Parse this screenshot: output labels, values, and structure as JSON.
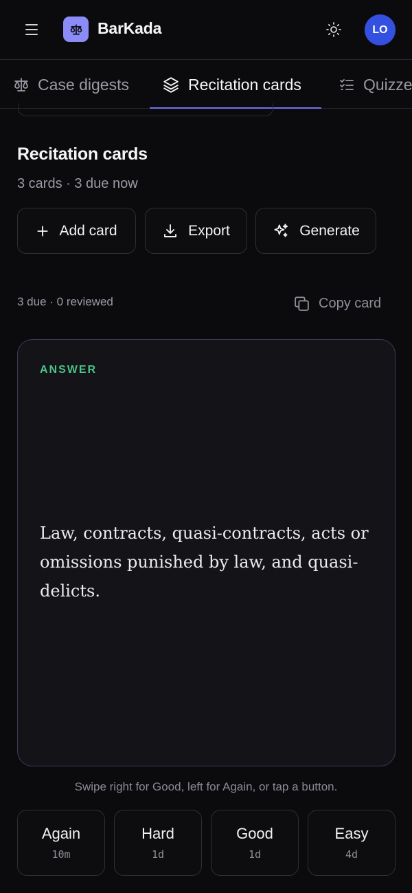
{
  "app": {
    "name": "BarKada",
    "user_initials": "LO"
  },
  "tabs": [
    {
      "label": "Case digests",
      "icon": "scale-icon",
      "active": false
    },
    {
      "label": "Recitation cards",
      "icon": "layers-icon",
      "active": true
    },
    {
      "label": "Quizzes",
      "icon": "checklist-icon",
      "active": false
    }
  ],
  "section": {
    "title": "Recitation cards",
    "subtitle": "3 cards · 3 due now"
  },
  "actions": {
    "add_label": "Add card",
    "export_label": "Export",
    "generate_label": "Generate"
  },
  "review": {
    "status": "3 due · 0 reviewed",
    "copy_label": "Copy card"
  },
  "card": {
    "side_label": "ANSWER",
    "text": "Law, contracts, quasi-contracts, acts or omissions punished by law, and quasi-delicts."
  },
  "hint": "Swipe right for Good, left for Again, or tap a button.",
  "ratings": [
    {
      "label": "Again",
      "interval": "10m"
    },
    {
      "label": "Hard",
      "interval": "1d"
    },
    {
      "label": "Good",
      "interval": "1d"
    },
    {
      "label": "Easy",
      "interval": "4d"
    }
  ],
  "colors": {
    "background": "#0b0b0e",
    "accent": "#6f74f0",
    "logo": "#8b8cf7",
    "avatar": "#3450e0",
    "answer_label": "#4cc38a"
  }
}
